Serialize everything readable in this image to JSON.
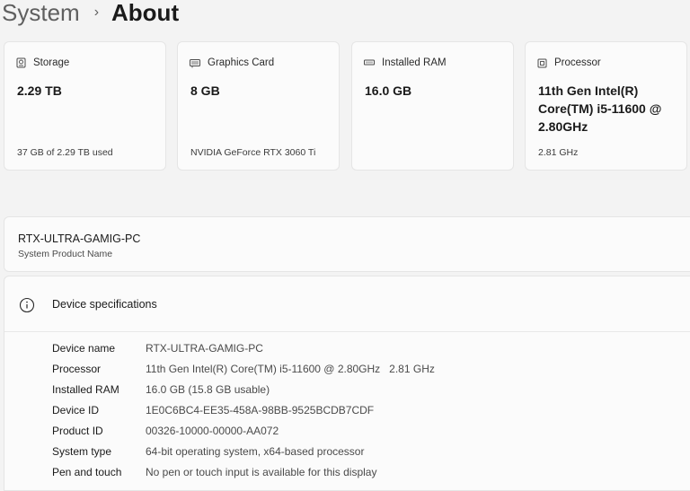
{
  "breadcrumb": {
    "parent": "System",
    "separator": "›",
    "current": "About"
  },
  "cards": [
    {
      "title": "Storage",
      "value": "2.29 TB",
      "subtitle": "37 GB of 2.29 TB used",
      "icon": "storage-icon"
    },
    {
      "title": "Graphics Card",
      "value": "8 GB",
      "subtitle": "NVIDIA GeForce RTX 3060 Ti",
      "icon": "graphics-card-icon"
    },
    {
      "title": "Installed RAM",
      "value": "16.0 GB",
      "subtitle": "",
      "icon": "ram-icon"
    },
    {
      "title": "Processor",
      "value": "11th Gen Intel(R) Core(TM) i5-11600 @ 2.80GHz",
      "subtitle": "2.81 GHz",
      "icon": "processor-icon"
    }
  ],
  "product": {
    "name": "RTX-ULTRA-GAMIG-PC",
    "label": "System Product Name"
  },
  "specs": {
    "title": "Device specifications",
    "icon": "info-icon",
    "rows": [
      {
        "label": "Device name",
        "value": "RTX-ULTRA-GAMIG-PC"
      },
      {
        "label": "Processor",
        "value": "11th Gen Intel(R) Core(TM) i5-11600 @ 2.80GHz   2.81 GHz"
      },
      {
        "label": "Installed RAM",
        "value": "16.0 GB (15.8 GB usable)"
      },
      {
        "label": "Device ID",
        "value": "1E0C6BC4-EE35-458A-98BB-9525BCDB7CDF"
      },
      {
        "label": "Product ID",
        "value": "00326-10000-00000-AA072"
      },
      {
        "label": "System type",
        "value": "64-bit operating system, x64-based processor"
      },
      {
        "label": "Pen and touch",
        "value": "No pen or touch input is available for this display"
      }
    ]
  },
  "colors": {
    "background": "#f3f3f3",
    "card": "#fbfbfb",
    "border": "#e5e5e5"
  }
}
